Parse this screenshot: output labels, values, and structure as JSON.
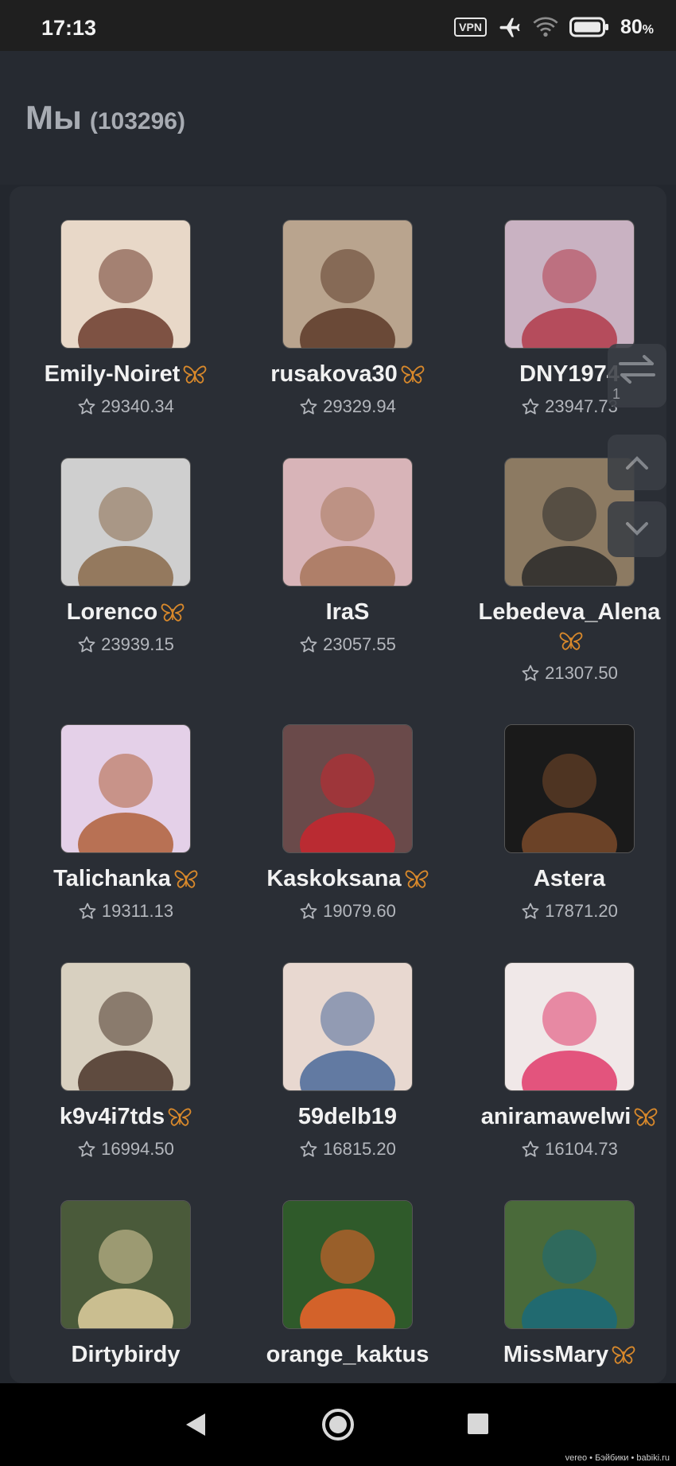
{
  "status_bar": {
    "time": "17:13",
    "vpn_label": "VPN",
    "battery_percent": "80",
    "battery_unit": "%"
  },
  "header": {
    "title": "Мы",
    "count": "(103296)"
  },
  "users": [
    {
      "name": "Emily-Noiret",
      "score": "29340.34",
      "butterfly": true
    },
    {
      "name": "rusakova30",
      "score": "29329.94",
      "butterfly": true
    },
    {
      "name": "DNY1974",
      "score": "23947.73",
      "butterfly": false
    },
    {
      "name": "Lorenco",
      "score": "23939.15",
      "butterfly": true
    },
    {
      "name": "IraS",
      "score": "23057.55",
      "butterfly": false
    },
    {
      "name": "Lebedeva_Alena",
      "score": "21307.50",
      "butterfly": true
    },
    {
      "name": "Talichanka",
      "score": "19311.13",
      "butterfly": true
    },
    {
      "name": "Kaskoksana",
      "score": "19079.60",
      "butterfly": true
    },
    {
      "name": "Astera",
      "score": "17871.20",
      "butterfly": false
    },
    {
      "name": "k9v4i7tds",
      "score": "16994.50",
      "butterfly": true
    },
    {
      "name": "59delb19",
      "score": "16815.20",
      "butterfly": false
    },
    {
      "name": "aniramawelwi",
      "score": "16104.73",
      "butterfly": true
    },
    {
      "name": "Dirtybirdy",
      "score": "",
      "butterfly": false
    },
    {
      "name": "orange_kaktus",
      "score": "",
      "butterfly": false
    },
    {
      "name": "MissMary",
      "score": "",
      "butterfly": true
    }
  ],
  "side_controls": {
    "swap_counter": "1"
  },
  "watermark": "vereo • Бэйбики • babiki.ru",
  "colors": {
    "background": "#23272e",
    "panel": "#2a2e35",
    "butterfly": "#d9892b",
    "muted_text": "#b4b7bd"
  }
}
